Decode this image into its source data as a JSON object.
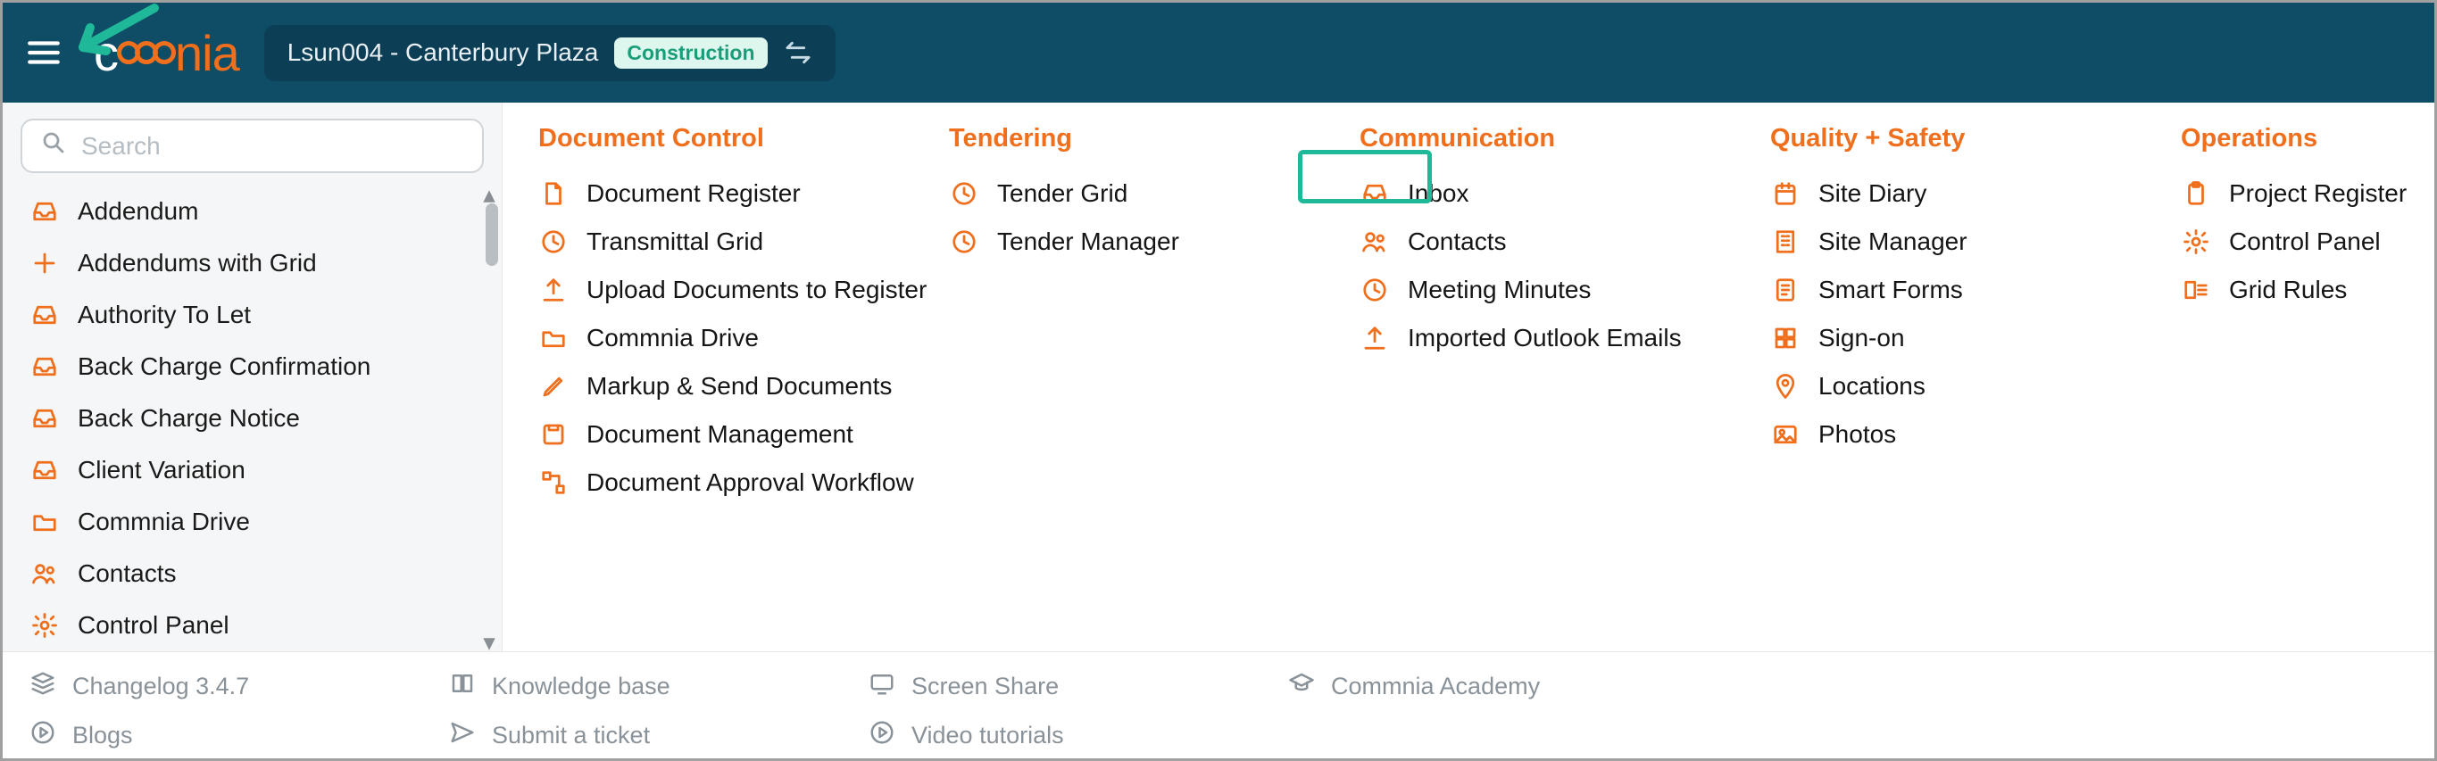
{
  "header": {
    "project_label": "Lsun004 - Canterbury Plaza",
    "project_badge": "Construction"
  },
  "search": {
    "placeholder": "Search"
  },
  "sidebar": {
    "items": [
      {
        "icon": "inbox-icon",
        "label": "Addendum"
      },
      {
        "icon": "plus-icon",
        "label": "Addendums with Grid"
      },
      {
        "icon": "inbox-icon",
        "label": "Authority To Let"
      },
      {
        "icon": "inbox-icon",
        "label": "Back Charge Confirmation"
      },
      {
        "icon": "inbox-icon",
        "label": "Back Charge Notice"
      },
      {
        "icon": "inbox-icon",
        "label": "Client Variation"
      },
      {
        "icon": "folder-icon",
        "label": "Commnia Drive"
      },
      {
        "icon": "people-icon",
        "label": "Contacts"
      },
      {
        "icon": "gear-icon",
        "label": "Control Panel"
      }
    ]
  },
  "mega": {
    "columns": [
      {
        "title": "Document Control",
        "items": [
          {
            "icon": "file-icon",
            "label": "Document Register"
          },
          {
            "icon": "clock-icon",
            "label": "Transmittal Grid"
          },
          {
            "icon": "upload-icon",
            "label": "Upload Documents to Register"
          },
          {
            "icon": "folder-icon",
            "label": "Commnia Drive"
          },
          {
            "icon": "pencil-icon",
            "label": "Markup & Send Documents"
          },
          {
            "icon": "filebox-icon",
            "label": "Document Management"
          },
          {
            "icon": "flow-icon",
            "label": "Document Approval Workflow"
          }
        ]
      },
      {
        "title": "Tendering",
        "items": [
          {
            "icon": "clock-icon",
            "label": "Tender Grid"
          },
          {
            "icon": "clock-icon",
            "label": "Tender Manager"
          }
        ]
      },
      {
        "title": "Communication",
        "items": [
          {
            "icon": "inbox-icon",
            "label": "Inbox"
          },
          {
            "icon": "people-icon",
            "label": "Contacts"
          },
          {
            "icon": "clock-icon",
            "label": "Meeting Minutes"
          },
          {
            "icon": "upload-icon",
            "label": "Imported Outlook Emails"
          }
        ]
      },
      {
        "title": "Quality + Safety",
        "items": [
          {
            "icon": "calendar-icon",
            "label": "Site Diary"
          },
          {
            "icon": "building-icon",
            "label": "Site Manager"
          },
          {
            "icon": "form-icon",
            "label": "Smart Forms"
          },
          {
            "icon": "grid-icon",
            "label": "Sign-on"
          },
          {
            "icon": "pin-icon",
            "label": "Locations"
          },
          {
            "icon": "photo-icon",
            "label": "Photos"
          }
        ]
      },
      {
        "title": "Operations",
        "items": [
          {
            "icon": "clipboard-icon",
            "label": "Project Register"
          },
          {
            "icon": "gear-icon",
            "label": "Control Panel"
          },
          {
            "icon": "rules-icon",
            "label": "Grid Rules"
          }
        ]
      }
    ]
  },
  "footer": {
    "col1": [
      {
        "icon": "stack-icon",
        "label": "Changelog 3.4.7"
      },
      {
        "icon": "play-circle-icon",
        "label": "Blogs"
      }
    ],
    "col2": [
      {
        "icon": "book-icon",
        "label": "Knowledge base"
      },
      {
        "icon": "send-icon",
        "label": "Submit a ticket"
      }
    ],
    "col3": [
      {
        "icon": "screen-icon",
        "label": "Screen Share"
      },
      {
        "icon": "play-circle-icon",
        "label": "Video tutorials"
      }
    ],
    "col4": [
      {
        "icon": "academy-icon",
        "label": "Commnia Academy"
      }
    ]
  }
}
